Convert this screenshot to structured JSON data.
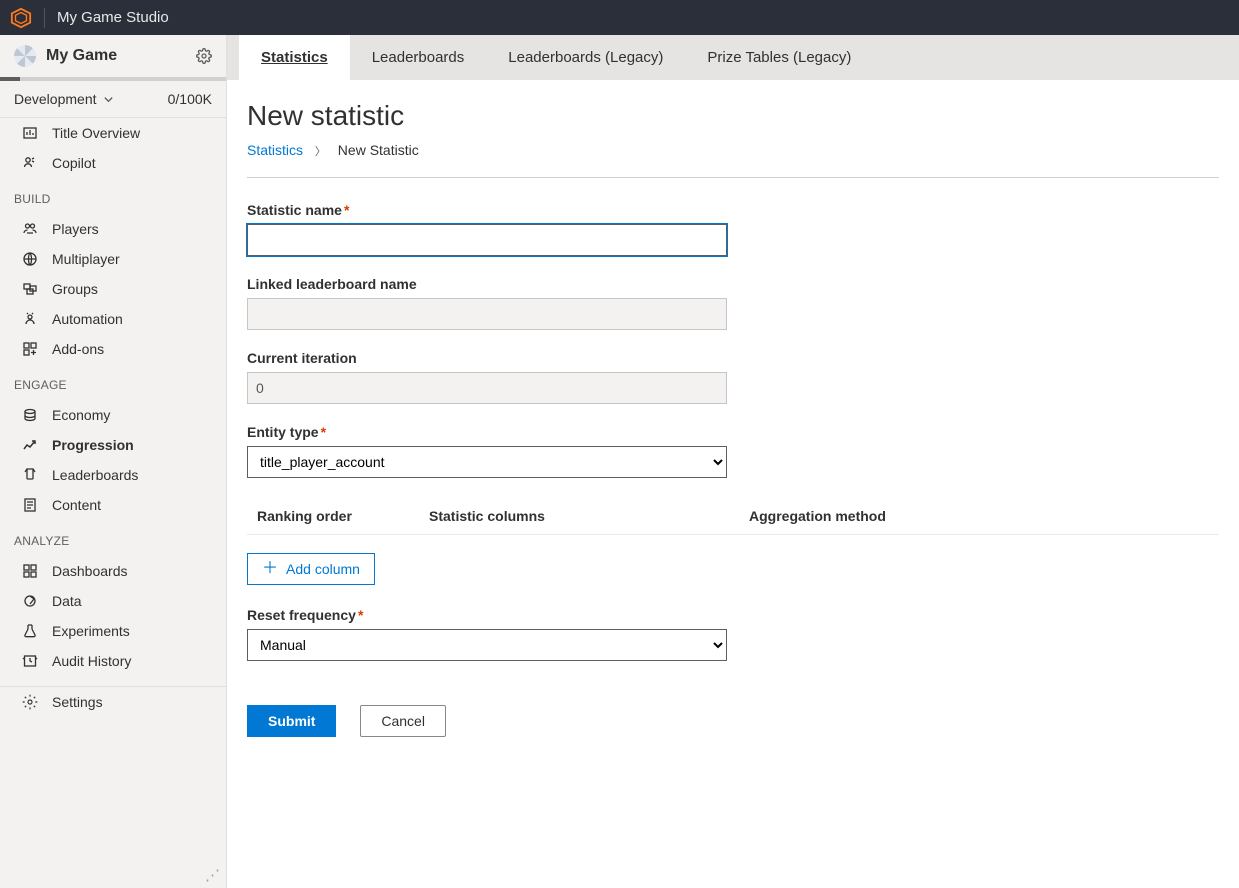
{
  "topbar": {
    "studio_name": "My Game Studio"
  },
  "sidebar": {
    "game_name": "My Game",
    "environment": "Development",
    "env_count": "0/100K",
    "flat_items": [
      {
        "icon": "overview",
        "label": "Title Overview"
      },
      {
        "icon": "copilot",
        "label": "Copilot"
      }
    ],
    "sections": [
      {
        "title": "BUILD",
        "items": [
          {
            "icon": "players",
            "label": "Players"
          },
          {
            "icon": "multiplayer",
            "label": "Multiplayer"
          },
          {
            "icon": "groups",
            "label": "Groups"
          },
          {
            "icon": "automation",
            "label": "Automation"
          },
          {
            "icon": "addons",
            "label": "Add-ons"
          }
        ]
      },
      {
        "title": "ENGAGE",
        "items": [
          {
            "icon": "economy",
            "label": "Economy"
          },
          {
            "icon": "progression",
            "label": "Progression",
            "active": true
          },
          {
            "icon": "leaderboards",
            "label": "Leaderboards"
          },
          {
            "icon": "content",
            "label": "Content"
          }
        ]
      },
      {
        "title": "ANALYZE",
        "items": [
          {
            "icon": "dashboards",
            "label": "Dashboards"
          },
          {
            "icon": "data",
            "label": "Data"
          },
          {
            "icon": "experiments",
            "label": "Experiments"
          },
          {
            "icon": "audit",
            "label": "Audit History"
          }
        ]
      }
    ],
    "settings_label": "Settings"
  },
  "tabs": [
    {
      "label": "Statistics",
      "active": true
    },
    {
      "label": "Leaderboards"
    },
    {
      "label": "Leaderboards (Legacy)"
    },
    {
      "label": "Prize Tables (Legacy)"
    }
  ],
  "page": {
    "title": "New statistic",
    "breadcrumb": {
      "root": "Statistics",
      "current": "New Statistic"
    }
  },
  "form": {
    "statistic_name": {
      "label": "Statistic name",
      "required": true,
      "value": ""
    },
    "linked_leaderboard": {
      "label": "Linked leaderboard name",
      "required": false,
      "value": "",
      "disabled": true
    },
    "current_iteration": {
      "label": "Current iteration",
      "required": false,
      "value": "0",
      "disabled": true
    },
    "entity_type": {
      "label": "Entity type",
      "required": true,
      "selected": "title_player_account",
      "options": [
        "title_player_account"
      ]
    },
    "columns_header": {
      "ranking": "Ranking order",
      "statcols": "Statistic columns",
      "agg": "Aggregation method"
    },
    "add_column_label": "Add column",
    "reset_frequency": {
      "label": "Reset frequency",
      "required": true,
      "selected": "Manual",
      "options": [
        "Manual"
      ]
    },
    "submit_label": "Submit",
    "cancel_label": "Cancel"
  }
}
